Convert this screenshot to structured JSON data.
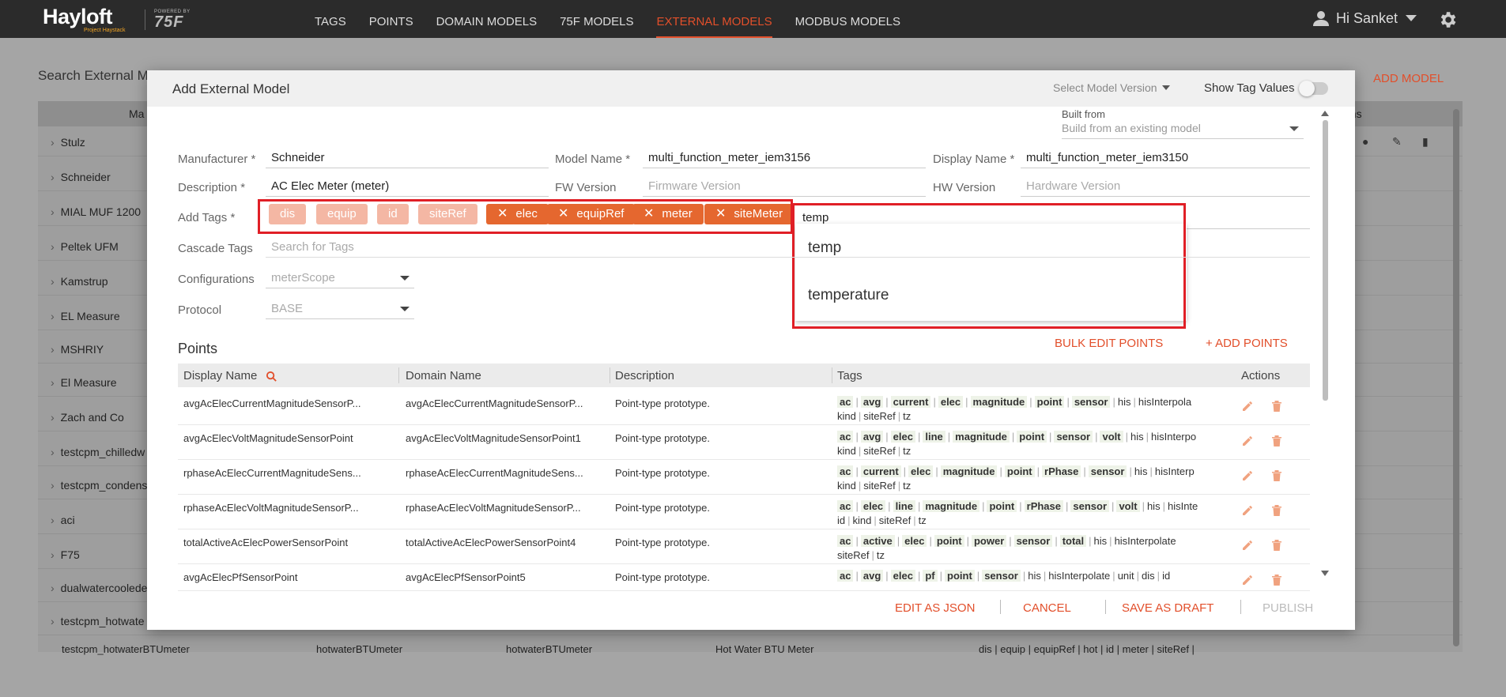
{
  "brand": {
    "logo": "Hayloft",
    "logo_sub": "Project Haystack",
    "powered_by": "POWERED BY",
    "powered_brand": "75F"
  },
  "nav": [
    {
      "label": "TAGS"
    },
    {
      "label": "POINTS"
    },
    {
      "label": "DOMAIN MODELS"
    },
    {
      "label": "75F MODELS"
    },
    {
      "label": "EXTERNAL MODELS"
    },
    {
      "label": "MODBUS MODELS"
    }
  ],
  "user": {
    "greeting": "Hi Sanket"
  },
  "background": {
    "search_label": "Search External M",
    "add_model": "ADD MODEL",
    "col_manufacturer": "Ma",
    "col_actions": "ons",
    "rows": [
      "Stulz",
      "Schneider",
      "MIAL MUF 1200",
      "Peltek UFM",
      "Kamstrup",
      "EL Measure",
      "MSHRIY",
      "El Measure",
      "Zach and Co",
      "testcpm_chilledw",
      "testcpm_condens",
      "aci",
      "F75",
      "dualwatercoolede",
      "testcpm_hotwate"
    ],
    "last_row": {
      "name": "testcpm_hotwaterBTUmeter",
      "domain": "hotwaterBTUmeter",
      "model": "hotwaterBTUmeter",
      "desc": "Hot Water BTU Meter",
      "tags": "dis | equip | equipRef | hot | id | meter | siteRef |"
    }
  },
  "modal": {
    "title": "Add External Model",
    "model_version_placeholder": "Select Model Version",
    "show_tag_values": "Show Tag Values",
    "built_from_label": "Built from",
    "built_from_placeholder": "Build from an existing model",
    "manufacturer_label": "Manufacturer *",
    "manufacturer": "Schneider",
    "model_name_label": "Model Name *",
    "model_name": "multi_function_meter_iem3156",
    "display_name_label": "Display Name *",
    "display_name": "multi_function_meter_iem3150",
    "description_label": "Description *",
    "description": "AC Elec Meter (meter)",
    "fw_label": "FW Version",
    "fw_placeholder": "Firmware Version",
    "hw_label": "HW Version",
    "hw_placeholder": "Hardware Version",
    "add_tags_label": "Add Tags *",
    "locked_tags": [
      "dis",
      "equip",
      "id",
      "siteRef"
    ],
    "removable_tags": [
      "elec",
      "equipRef",
      "meter",
      "siteMeter"
    ],
    "tag_input": "temp",
    "suggestions": [
      "temp",
      "temperature"
    ],
    "cascade_label": "Cascade Tags",
    "cascade_placeholder": "Search for Tags",
    "config_label": "Configurations",
    "config_value": "meterScope",
    "protocol_label": "Protocol",
    "protocol_value": "BASE",
    "points_title": "Points",
    "bulk_edit": "BULK EDIT POINTS",
    "add_points": "+ ADD POINTS",
    "columns": {
      "display_name": "Display Name",
      "domain_name": "Domain Name",
      "description": "Description",
      "tags": "Tags",
      "actions": "Actions"
    },
    "points": [
      {
        "display": "avgAcElecCurrentMagnitudeSensorP...",
        "domain": "avgAcElecCurrentMagnitudeSensorP...",
        "desc": "Point-type prototype.",
        "bold": [
          "ac",
          "avg",
          "current",
          "elec",
          "magnitude",
          "point",
          "sensor"
        ],
        "plain": [
          "his",
          "hisInterpola"
        ],
        "line2": [
          "kind",
          "siteRef",
          "tz"
        ]
      },
      {
        "display": "avgAcElecVoltMagnitudeSensorPoint",
        "domain": "avgAcElecVoltMagnitudeSensorPoint1",
        "desc": "Point-type prototype.",
        "bold": [
          "ac",
          "avg",
          "elec",
          "line",
          "magnitude",
          "point",
          "sensor",
          "volt"
        ],
        "plain": [
          "his",
          "hisInterpo"
        ],
        "line2": [
          "kind",
          "siteRef",
          "tz"
        ]
      },
      {
        "display": "rphaseAcElecCurrentMagnitudeSens...",
        "domain": "rphaseAcElecCurrentMagnitudeSens...",
        "desc": "Point-type prototype.",
        "bold": [
          "ac",
          "current",
          "elec",
          "magnitude",
          "point",
          "rPhase",
          "sensor"
        ],
        "plain": [
          "his",
          "hisInterp"
        ],
        "line2": [
          "kind",
          "siteRef",
          "tz"
        ]
      },
      {
        "display": "rphaseAcElecVoltMagnitudeSensorP...",
        "domain": "rphaseAcElecVoltMagnitudeSensorP...",
        "desc": "Point-type prototype.",
        "bold": [
          "ac",
          "elec",
          "line",
          "magnitude",
          "point",
          "rPhase",
          "sensor",
          "volt"
        ],
        "plain": [
          "his",
          "hisInte"
        ],
        "line2": [
          "id",
          "kind",
          "siteRef",
          "tz"
        ]
      },
      {
        "display": "totalActiveAcElecPowerSensorPoint",
        "domain": "totalActiveAcElecPowerSensorPoint4",
        "desc": "Point-type prototype.",
        "bold": [
          "ac",
          "active",
          "elec",
          "point",
          "power",
          "sensor",
          "total"
        ],
        "plain": [
          "his",
          "hisInterpolate"
        ],
        "line2": [
          "siteRef",
          "tz"
        ]
      },
      {
        "display": "avgAcElecPfSensorPoint",
        "domain": "avgAcElecPfSensorPoint5",
        "desc": "Point-type prototype.",
        "bold": [
          "ac",
          "avg",
          "elec",
          "pf",
          "point",
          "sensor"
        ],
        "plain": [
          "his",
          "hisInterpolate",
          "unit",
          "dis",
          "id"
        ],
        "line2": []
      }
    ],
    "footer": {
      "edit_json": "EDIT AS JSON",
      "cancel": "CANCEL",
      "save_draft": "SAVE AS DRAFT",
      "publish": "PUBLISH"
    }
  },
  "colors": {
    "accent": "#e24f2b",
    "chip_dark": "#e5672f",
    "chip_light": "#f4b7a4",
    "highlight": "#e01f26"
  }
}
